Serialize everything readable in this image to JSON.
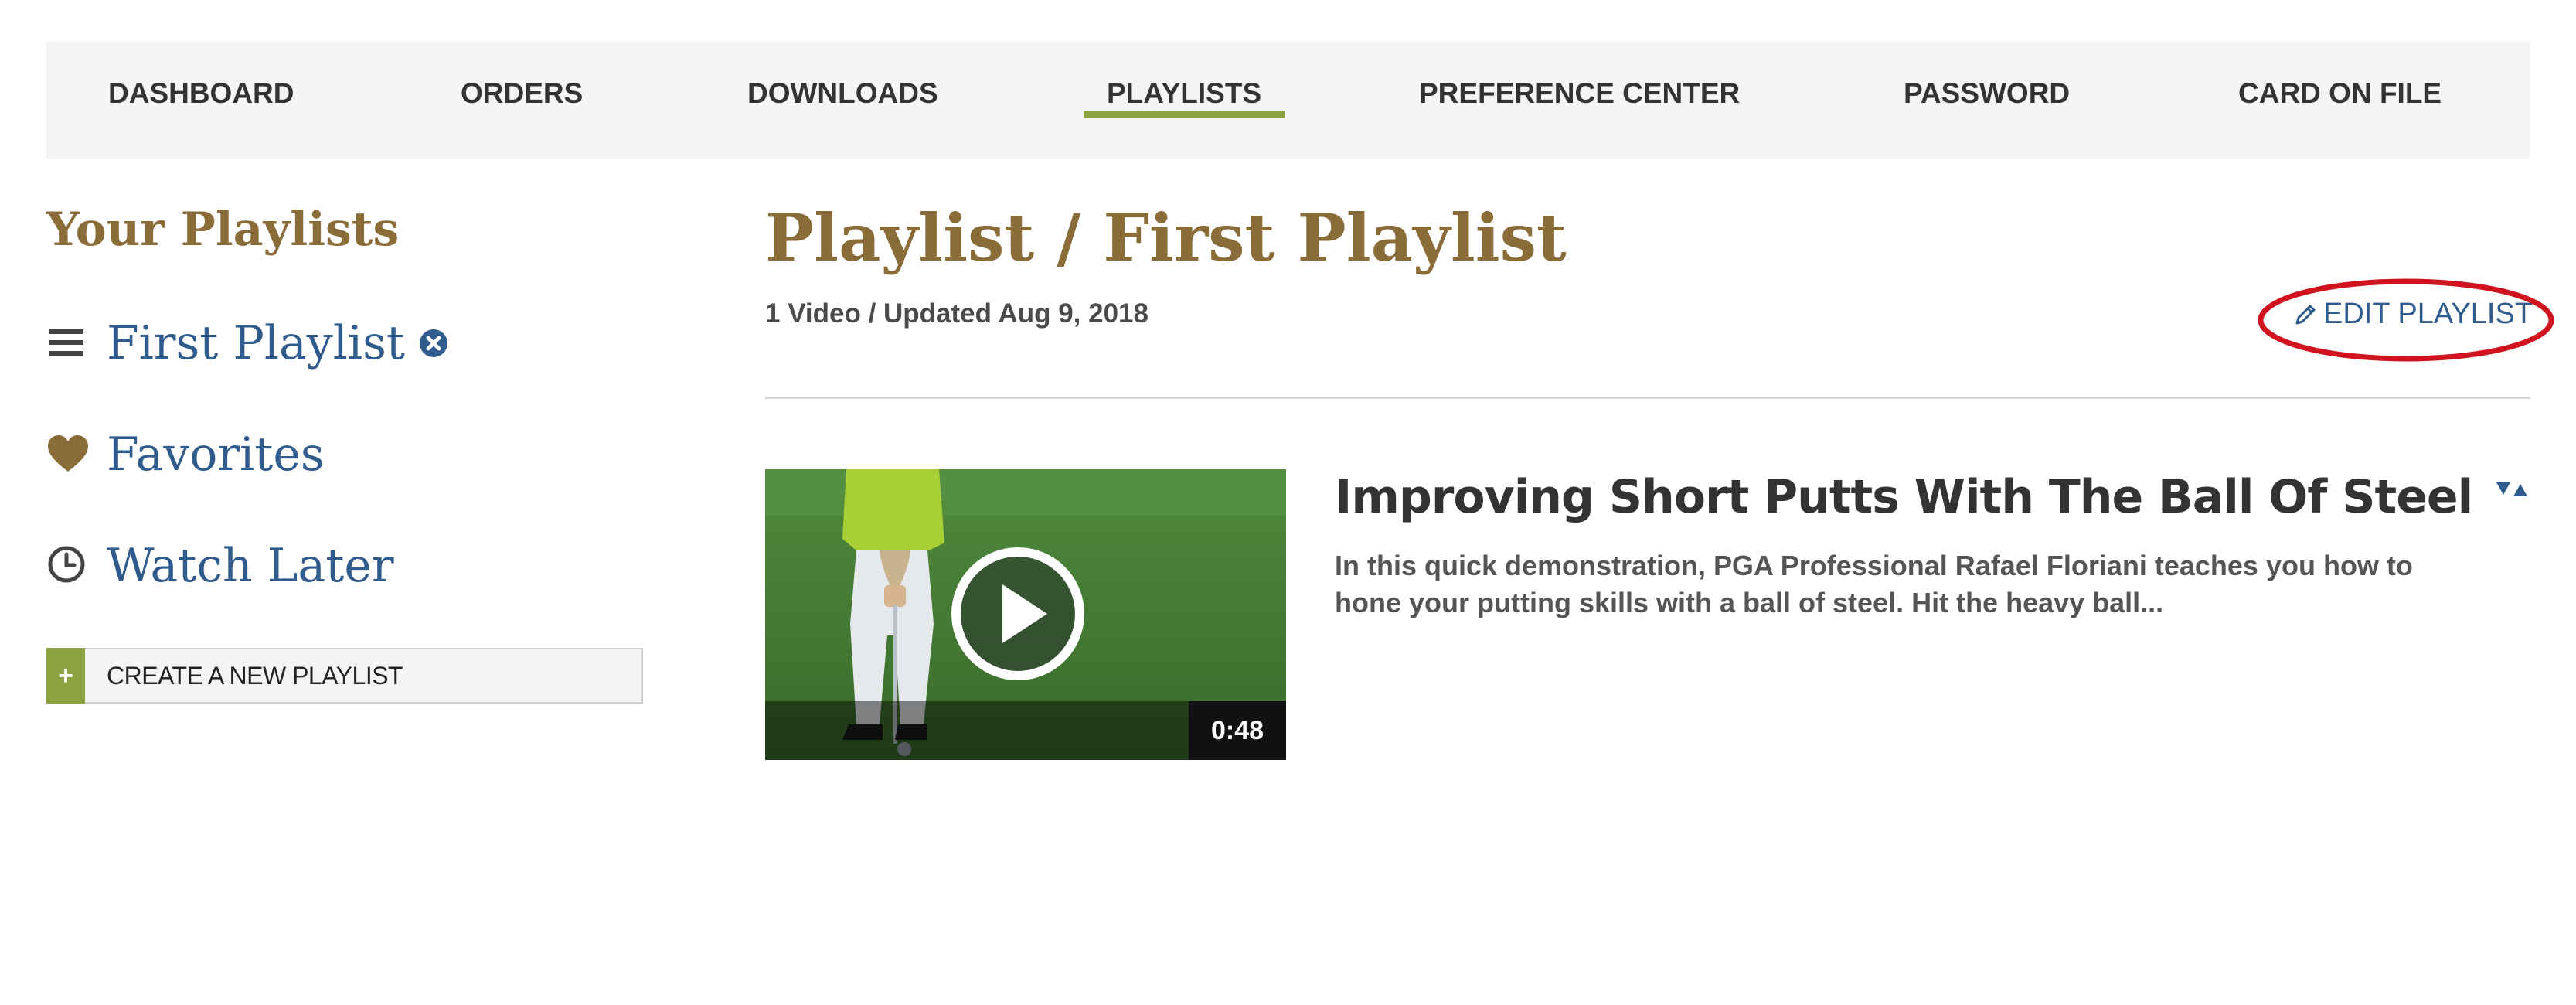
{
  "nav": {
    "items": [
      {
        "label": "DASHBOARD",
        "active": false
      },
      {
        "label": "ORDERS",
        "active": false
      },
      {
        "label": "DOWNLOADS",
        "active": false
      },
      {
        "label": "PLAYLISTS",
        "active": true
      },
      {
        "label": "PREFERENCE CENTER",
        "active": false
      },
      {
        "label": "PASSWORD",
        "active": false
      },
      {
        "label": "CARD ON FILE",
        "active": false
      }
    ]
  },
  "sidebar": {
    "title": "Your Playlists",
    "items": [
      {
        "label": "First Playlist",
        "icon": "list-icon",
        "removable": true
      },
      {
        "label": "Favorites",
        "icon": "heart-icon",
        "removable": false
      },
      {
        "label": "Watch Later",
        "icon": "clock-icon",
        "removable": false
      }
    ],
    "create_button": {
      "plus": "+",
      "label": "CREATE A NEW PLAYLIST"
    }
  },
  "main": {
    "crumb_prefix": "Playlist / ",
    "crumb_title": "First Playlist",
    "meta": "1 Video / Updated Aug 9, 2018",
    "edit_label": "EDIT PLAYLIST",
    "edit_icon": "pencil-icon",
    "video": {
      "title": "Improving Short Putts With The Ball Of Steel",
      "description": "In this quick demonstration, PGA Professional Rafael Floriani teaches you how to hone your putting skills with a ball of steel. Hit the heavy ball...",
      "duration": "0:48"
    }
  },
  "colors": {
    "accent_green": "#8ca13f",
    "brand_brown": "#8a6c38",
    "link_blue": "#2f5b8d",
    "annotation_red": "#d0131f",
    "nav_bg": "#f5f6f4"
  }
}
